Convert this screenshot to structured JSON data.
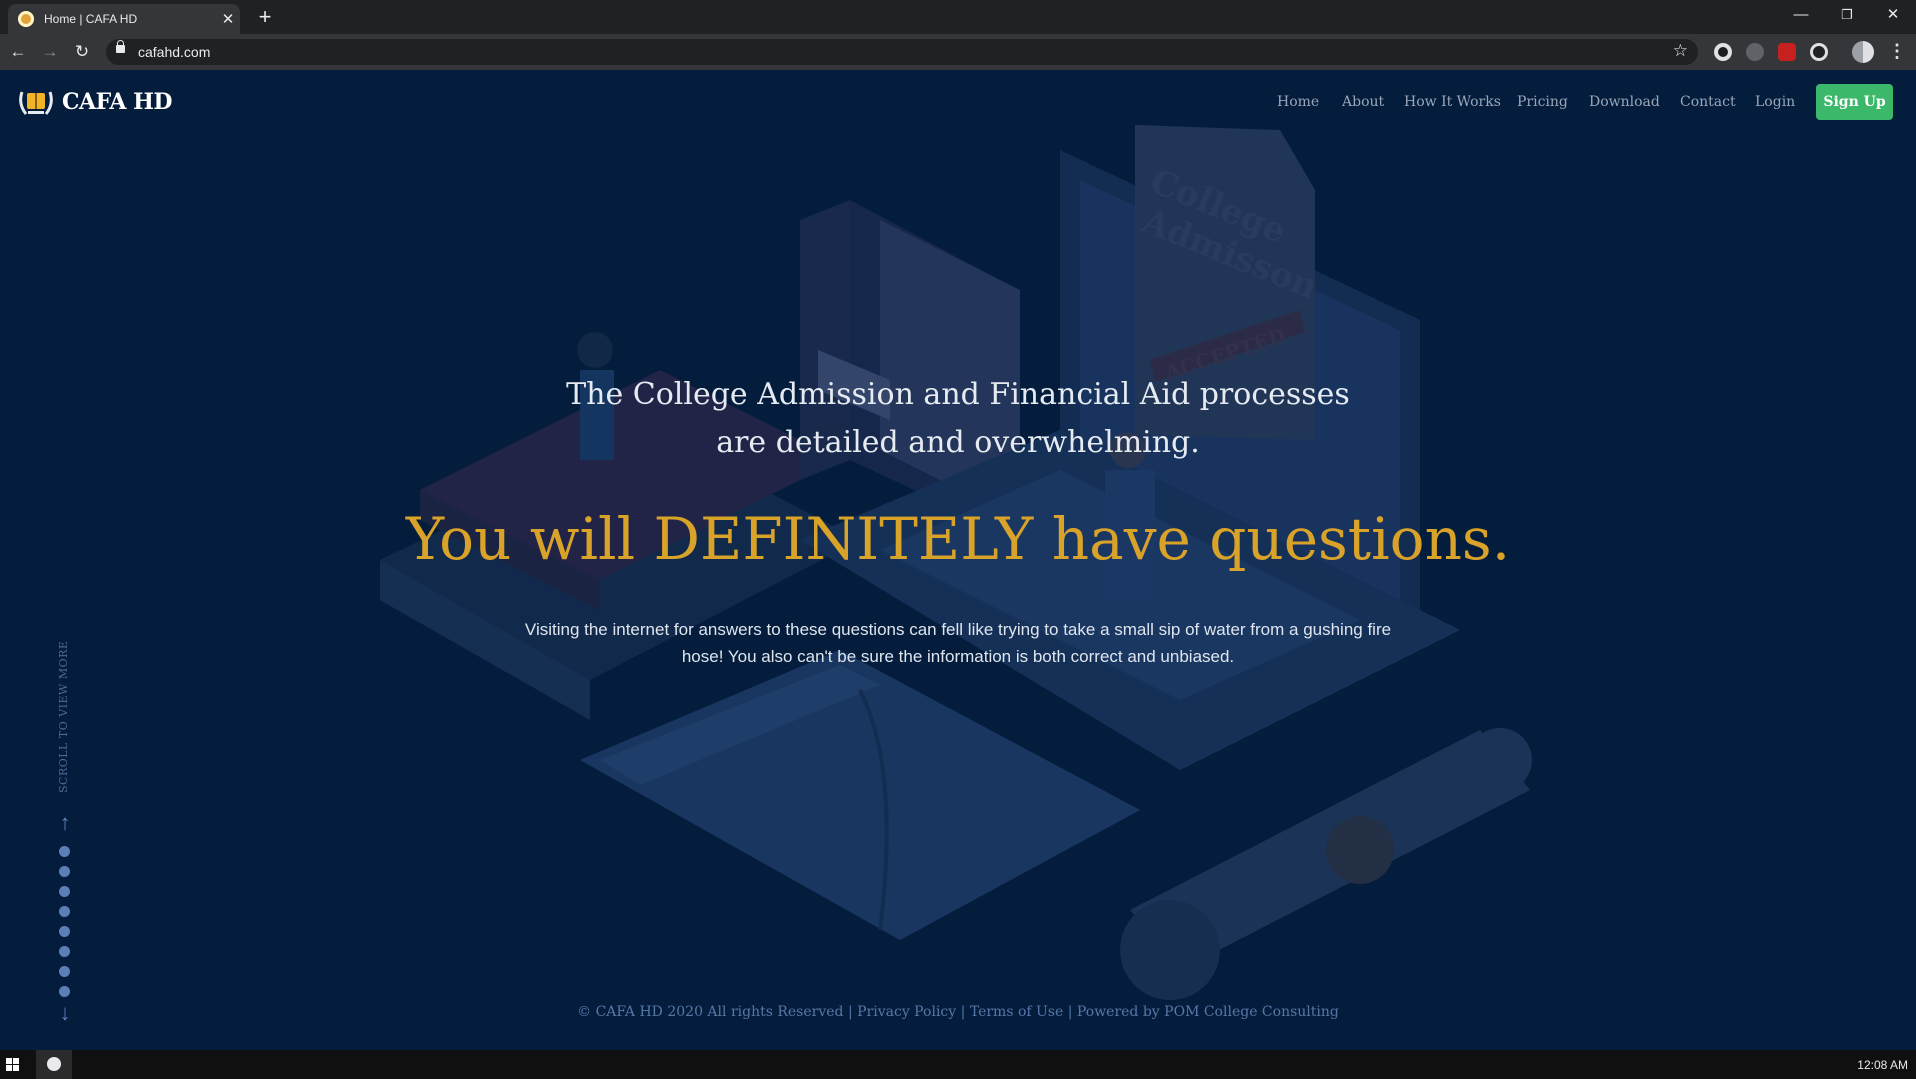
{
  "browser": {
    "tab_title": "Home | CAFA HD",
    "url": "cafahd.com",
    "new_tab_symbol": "+",
    "close_symbol": "✕",
    "star_symbol": "☆"
  },
  "site": {
    "brand": "CAFA HD",
    "nav": [
      "Home",
      "About",
      "How It Works",
      "Pricing",
      "Download",
      "Contact",
      "Login"
    ],
    "signup_label": "Sign Up"
  },
  "hero": {
    "subtitle_line1": "The College Admission and Financial Aid processes",
    "subtitle_line2": "are detailed and overwhelming.",
    "title": "You will DEFINITELY have questions.",
    "body": "Visiting the internet for answers to these questions can fell like trying to take a small sip of water from a gushing fire hose! You also can't be sure the information is both correct and unbiased."
  },
  "illustration": {
    "doc_text_1": "College",
    "doc_text_2": "Admisson",
    "stamp_text": "ACCEPTED"
  },
  "scroll": {
    "label": "SCROLL TO VIEW MORE",
    "dot_count": 8
  },
  "footer": {
    "copyright": "© CAFA HD 2020 All rights Reserved",
    "separator": " | ",
    "privacy": "Privacy Policy",
    "terms": "Terms of Use",
    "powered": "Powered by POM College Consulting"
  },
  "taskbar": {
    "time": "12:08 AM"
  },
  "colors": {
    "page_bg": "#041d3d",
    "accent_gold": "#d9a32a",
    "signup_green": "#3cb86a",
    "nav_text": "#9aa6b8"
  },
  "icons": [
    "tab-favicon-icon",
    "close-icon",
    "back-icon",
    "forward-icon",
    "reload-icon",
    "lock-icon",
    "star-icon",
    "extension-icons",
    "profile-icon",
    "menu-icon",
    "logo-crest-icon",
    "arrow-up-icon",
    "arrow-down-icon",
    "windows-start-icon"
  ]
}
